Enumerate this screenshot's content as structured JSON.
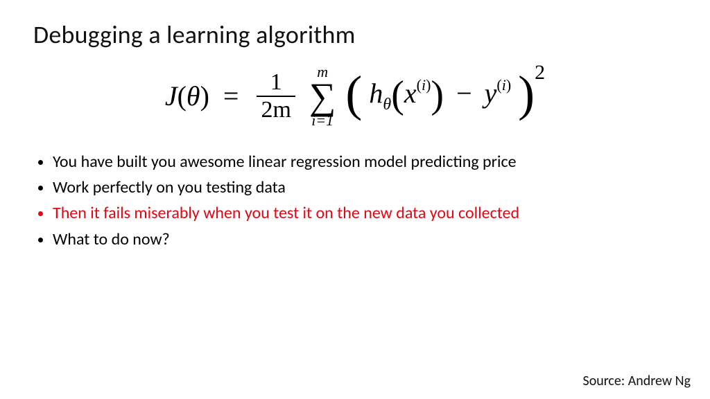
{
  "title": "Debugging a learning algorithm",
  "formula": {
    "lhs_fn": "J",
    "lhs_arg": "θ",
    "frac_num": "1",
    "frac_den": "2m",
    "sum_upper": "m",
    "sum_symbol": "∑",
    "sum_lower": "i=1",
    "h": "h",
    "h_sub": "θ",
    "x": "x",
    "idx_open": "(",
    "idx_i": "i",
    "idx_close": ")",
    "minus": "−",
    "y": "y",
    "power": "2",
    "equals": "="
  },
  "bullets": [
    {
      "text": "You have built you awesome linear regression model predicting price",
      "red": false
    },
    {
      "text": "Work perfectly on you testing data",
      "red": false
    },
    {
      "text": "Then it fails miserably when you test it on the new data you collected",
      "red": true
    },
    {
      "text": "What to do now?",
      "red": false
    }
  ],
  "source": "Source: Andrew Ng"
}
